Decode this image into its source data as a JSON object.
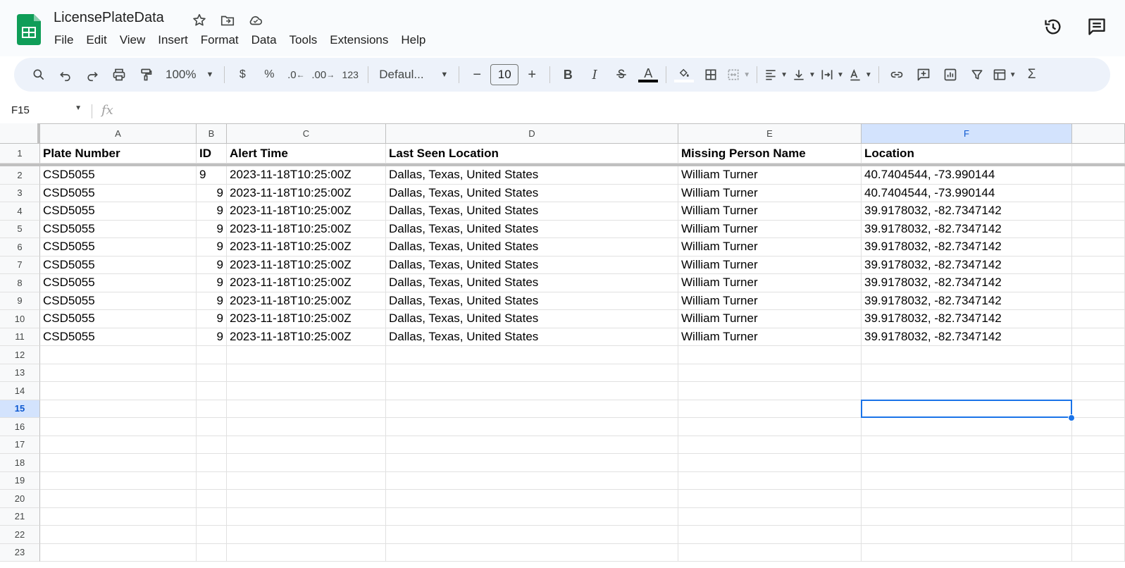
{
  "app": {
    "title": "LicensePlateData",
    "menu": [
      "File",
      "Edit",
      "View",
      "Insert",
      "Format",
      "Data",
      "Tools",
      "Extensions",
      "Help"
    ]
  },
  "toolbar": {
    "zoom": "100%",
    "currency": "$",
    "percent": "%",
    "dec_decrease": ".0",
    "dec_increase": ".00",
    "number_format": "123",
    "font": "Defaul...",
    "font_size": "10",
    "minus": "−",
    "plus": "+",
    "bold": "B",
    "italic": "I",
    "text_color": "A",
    "sum": "Σ"
  },
  "formula_bar": {
    "cell_ref": "F15",
    "fx": "fx"
  },
  "columns": [
    "A",
    "B",
    "C",
    "D",
    "E",
    "F"
  ],
  "header_row": [
    "Plate Number",
    "ID",
    "Alert Time",
    "Last Seen Location",
    "Missing Person Name",
    "Location"
  ],
  "rows": [
    [
      "CSD5055",
      "9",
      "2023-11-18T10:25:00Z",
      "Dallas, Texas, United States",
      "William Turner",
      "40.7404544, -73.990144"
    ],
    [
      "CSD5055",
      "9",
      "2023-11-18T10:25:00Z",
      "Dallas, Texas, United States",
      "William Turner",
      "40.7404544, -73.990144"
    ],
    [
      "CSD5055",
      "9",
      "2023-11-18T10:25:00Z",
      "Dallas, Texas, United States",
      "William Turner",
      "39.9178032, -82.7347142"
    ],
    [
      "CSD5055",
      "9",
      "2023-11-18T10:25:00Z",
      "Dallas, Texas, United States",
      "William Turner",
      "39.9178032, -82.7347142"
    ],
    [
      "CSD5055",
      "9",
      "2023-11-18T10:25:00Z",
      "Dallas, Texas, United States",
      "William Turner",
      "39.9178032, -82.7347142"
    ],
    [
      "CSD5055",
      "9",
      "2023-11-18T10:25:00Z",
      "Dallas, Texas, United States",
      "William Turner",
      "39.9178032, -82.7347142"
    ],
    [
      "CSD5055",
      "9",
      "2023-11-18T10:25:00Z",
      "Dallas, Texas, United States",
      "William Turner",
      "39.9178032, -82.7347142"
    ],
    [
      "CSD5055",
      "9",
      "2023-11-18T10:25:00Z",
      "Dallas, Texas, United States",
      "William Turner",
      "39.9178032, -82.7347142"
    ],
    [
      "CSD5055",
      "9",
      "2023-11-18T10:25:00Z",
      "Dallas, Texas, United States",
      "William Turner",
      "39.9178032, -82.7347142"
    ],
    [
      "CSD5055",
      "9",
      "2023-11-18T10:25:00Z",
      "Dallas, Texas, United States",
      "William Turner",
      "39.9178032, -82.7347142"
    ]
  ],
  "row_numbers": [
    "1",
    "2",
    "3",
    "4",
    "5",
    "6",
    "7",
    "8",
    "9",
    "10",
    "11",
    "12",
    "13",
    "14",
    "15",
    "16",
    "17",
    "18",
    "19",
    "20",
    "21",
    "22",
    "23"
  ],
  "selected_cell": {
    "col": "F",
    "row": "15"
  },
  "colors": {
    "accent": "#1a73e8",
    "sheets_green": "#0f9d58",
    "toolbar_bg": "#edf2fa"
  }
}
